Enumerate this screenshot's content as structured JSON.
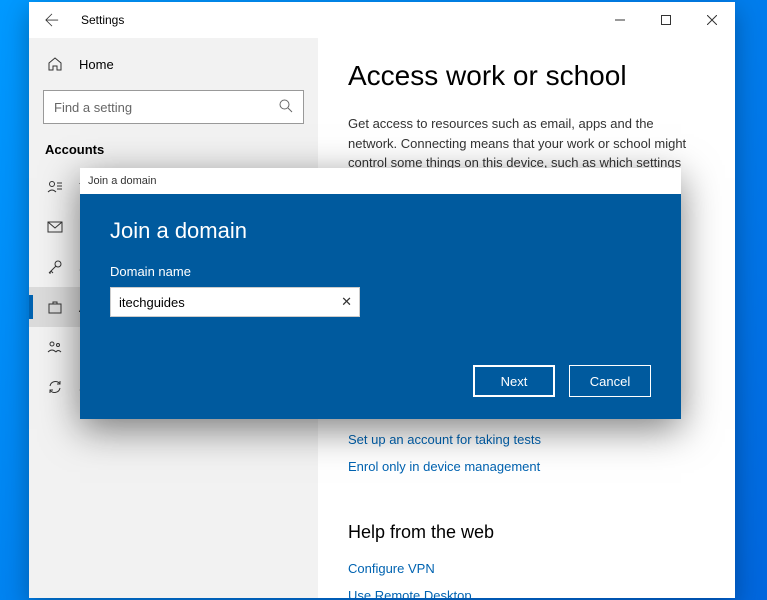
{
  "titlebar": {
    "title": "Settings"
  },
  "sidebar": {
    "home": "Home",
    "search_placeholder": "Find a setting",
    "section": "Accounts",
    "items": [
      {
        "label": "Yo"
      },
      {
        "label": "En"
      },
      {
        "label": "Si"
      },
      {
        "label": "A"
      },
      {
        "label": "Fa"
      },
      {
        "label": "Sync your settings"
      }
    ]
  },
  "main": {
    "heading": "Access work or school",
    "description": "Get access to resources such as email, apps and the network. Connecting means that your work or school might control some things on this device, such as which settings you can change. Ask",
    "link1": "Set up an account for taking tests",
    "link2": "Enrol only in device management",
    "help_heading": "Help from the web",
    "help_link1": "Configure VPN",
    "help_link2": "Use Remote Desktop"
  },
  "dialog": {
    "titlebar": "Join a domain",
    "heading": "Join a domain",
    "label": "Domain name",
    "value": "itechguides",
    "next": "Next",
    "cancel": "Cancel"
  }
}
